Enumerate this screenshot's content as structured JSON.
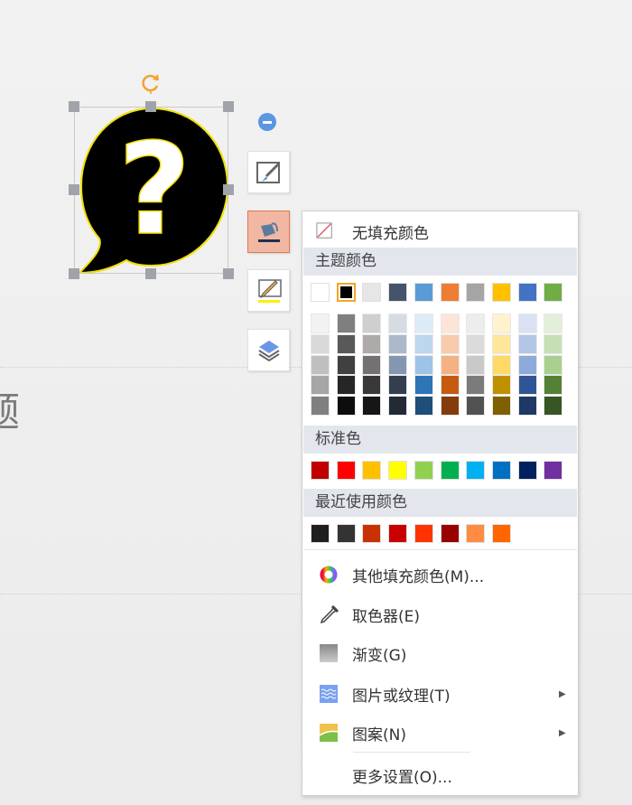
{
  "canvas": {
    "partial_title_char": "题"
  },
  "menu": {
    "no_fill": "无填充颜色",
    "theme_header": "主题颜色",
    "theme_colors": [
      "#ffffff",
      "#000000",
      "#e7e6e6",
      "#44546a",
      "#5b9bd5",
      "#ed7d31",
      "#a5a5a5",
      "#ffc000",
      "#4472c4",
      "#70ad47"
    ],
    "selected_theme_index": 1,
    "theme_shades": [
      [
        "#f2f2f2",
        "#d9d9d9",
        "#bfbfbf",
        "#a6a6a6",
        "#808080"
      ],
      [
        "#7f7f7f",
        "#595959",
        "#404040",
        "#262626",
        "#0d0d0d"
      ],
      [
        "#d0cece",
        "#aeaaaa",
        "#757171",
        "#3a3838",
        "#171616"
      ],
      [
        "#d6dce4",
        "#adb9ca",
        "#8497b0",
        "#333f4f",
        "#222a35"
      ],
      [
        "#ddebf7",
        "#bdd7ee",
        "#9dc3e6",
        "#2e75b6",
        "#1f4e79"
      ],
      [
        "#fce4d6",
        "#f8cbad",
        "#f4b183",
        "#c55a11",
        "#843c0c"
      ],
      [
        "#ededed",
        "#dbdbdb",
        "#c9c9c9",
        "#7b7b7b",
        "#525252"
      ],
      [
        "#fff2cc",
        "#ffe699",
        "#ffd966",
        "#bf9000",
        "#7f6000"
      ],
      [
        "#d9e1f2",
        "#b4c6e7",
        "#8eaadb",
        "#2f5597",
        "#1f3864"
      ],
      [
        "#e2efda",
        "#c6e0b4",
        "#a9d08e",
        "#548235",
        "#375623"
      ]
    ],
    "standard_header": "标准色",
    "standard_colors": [
      "#c00000",
      "#ff0000",
      "#ffc000",
      "#ffff00",
      "#92d050",
      "#00b050",
      "#00b0f0",
      "#0070c0",
      "#002060",
      "#7030a0"
    ],
    "recent_header": "最近使用颜色",
    "recent_colors": [
      "#1f1f1f",
      "#333333",
      "#c83200",
      "#c80000",
      "#ff3300",
      "#990000",
      "#ff8c40",
      "#ff6600"
    ],
    "items": [
      {
        "label": "其他填充颜色(M)...",
        "icon": "color-wheel-icon"
      },
      {
        "label": "取色器(E)",
        "icon": "eyedropper-icon"
      },
      {
        "label": "渐变(G)",
        "icon": "gradient-icon"
      },
      {
        "label": "图片或纹理(T)",
        "icon": "texture-icon",
        "submenu": true
      },
      {
        "label": "图案(N)",
        "icon": "pattern-icon",
        "submenu": true
      }
    ],
    "more_settings": "更多设置(O)..."
  }
}
